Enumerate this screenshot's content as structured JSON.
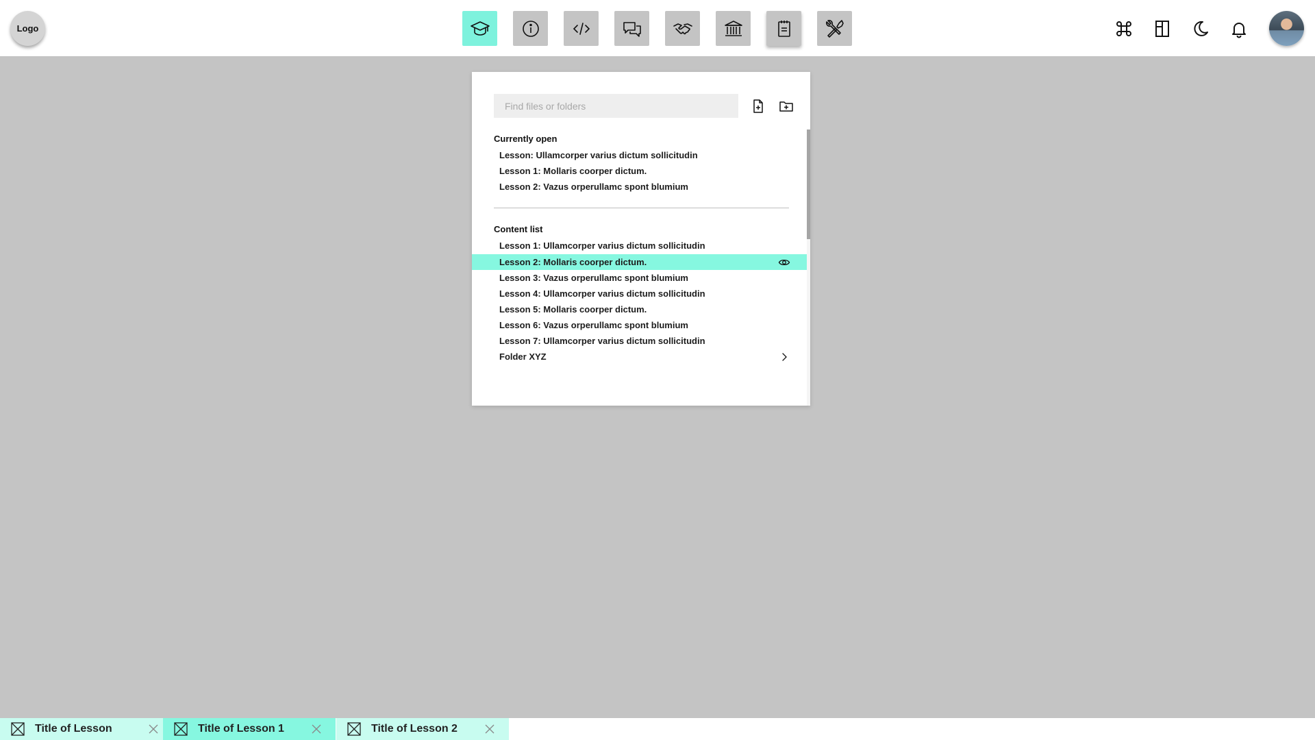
{
  "header": {
    "logo_label": "Logo",
    "tools": [
      {
        "icon": "graduation-cap-icon",
        "active": true
      },
      {
        "icon": "info-icon"
      },
      {
        "icon": "code-icon"
      },
      {
        "icon": "chat-icon"
      },
      {
        "icon": "handshake-icon"
      },
      {
        "icon": "institution-icon"
      },
      {
        "icon": "notepad-icon"
      },
      {
        "icon": "tools-icon"
      }
    ],
    "right_icons": [
      "command-icon",
      "layout-icon",
      "dark-mode-icon",
      "bell-icon",
      "avatar"
    ]
  },
  "panel": {
    "search_placeholder": "Find files or folders",
    "currently_open": {
      "title": "Currently open",
      "items": [
        "Lesson: Ullamcorper varius dictum sollicitudin",
        "Lesson 1: Mollaris coorper dictum.",
        "Lesson 2: Vazus orperullamc spont blumium"
      ]
    },
    "content_list": {
      "title": "Content list",
      "items": [
        "Lesson 1: Ullamcorper varius dictum sollicitudin",
        "Lesson 2: Mollaris coorper dictum.",
        "Lesson 3: Vazus orperullamc spont blumium",
        "Lesson 4: Ullamcorper varius dictum sollicitudin",
        "Lesson 5: Mollaris coorper dictum.",
        "Lesson 6: Vazus orperullamc spont blumium",
        "Lesson 7: Ullamcorper varius dictum sollicitudin",
        "Folder XYZ"
      ],
      "selected_index": 1
    }
  },
  "tabs": [
    {
      "title": "Title of Lesson"
    },
    {
      "title": "Title of Lesson 1"
    },
    {
      "title": "Title of Lesson 2"
    }
  ],
  "colors": {
    "accent": "#86f7e0",
    "accent_light": "#c8fcf0",
    "background": "#c4c4c4"
  }
}
